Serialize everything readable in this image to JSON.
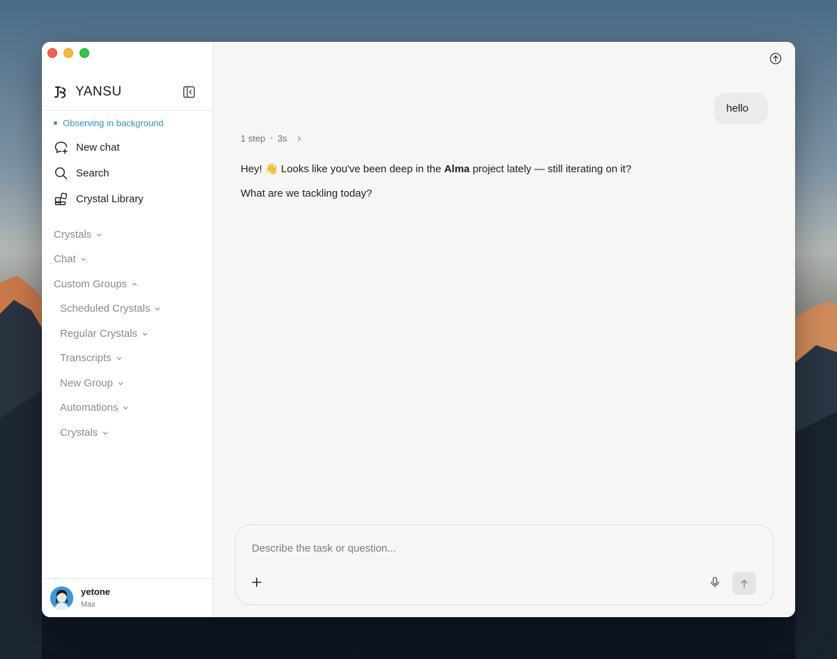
{
  "app": {
    "brand": "YANSU",
    "status": "Observing in background"
  },
  "nav": [
    {
      "label": "New chat",
      "icon": "new-chat-icon"
    },
    {
      "label": "Search",
      "icon": "search-icon"
    },
    {
      "label": "Crystal Library",
      "icon": "library-icon"
    }
  ],
  "groups": {
    "crystals": "Crystals",
    "chat": "Chat",
    "custom_groups": "Custom Groups",
    "children": [
      {
        "label": "Scheduled Crystals"
      },
      {
        "label": "Regular Crystals"
      },
      {
        "label": "Transcripts"
      },
      {
        "label": "New Group"
      },
      {
        "label": "Automations"
      },
      {
        "label": "Crystals"
      }
    ]
  },
  "user": {
    "name": "yetone",
    "plan": "Max"
  },
  "conversation": {
    "user_message": "hello",
    "steps": "1 step",
    "duration": "3s",
    "reply_pre": "Hey! 👋 Looks like you've been deep in the ",
    "reply_bold": "Alma",
    "reply_post": " project lately — still iterating on it?",
    "reply_line2": "What are we tackling today?"
  },
  "composer": {
    "placeholder": "Describe the task or question..."
  },
  "colors": {
    "accent": "#2f8fd8",
    "window_bg": "#f6f6f5",
    "sidebar_bg": "#ffffff"
  }
}
